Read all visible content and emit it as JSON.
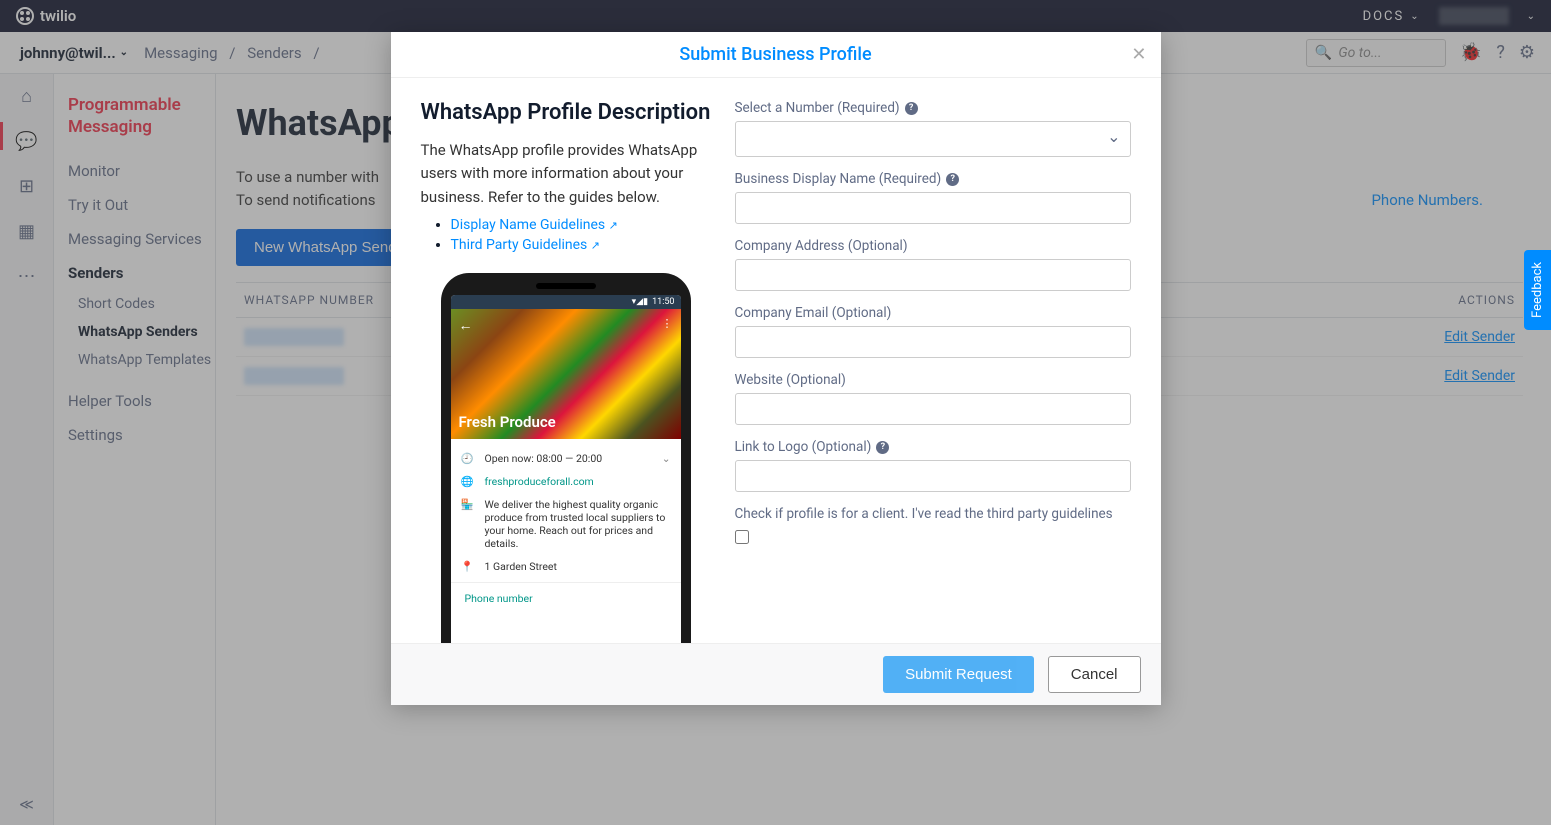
{
  "topbar": {
    "brand": "twilio",
    "docs": "DOCS"
  },
  "secondbar": {
    "account": "johnny@twil...",
    "crumb1": "Messaging",
    "crumb2": "Senders",
    "search_placeholder": "Go to..."
  },
  "sidebar": {
    "title": "Programmable Messaging",
    "items": {
      "monitor": "Monitor",
      "tryit": "Try it Out",
      "services": "Messaging Services",
      "senders": "Senders",
      "short_codes": "Short Codes",
      "whatsapp_senders": "WhatsApp Senders",
      "whatsapp_templates": "WhatsApp Templates",
      "helper": "Helper Tools",
      "settings": "Settings"
    }
  },
  "page": {
    "title": "WhatsApp",
    "desc1": "To use a number with",
    "desc2": "To send notifications",
    "link_phone": "Phone Numbers.",
    "btn_new": "New WhatsApp Sender",
    "col_number": "WHATSAPP NUMBER",
    "col_actions": "ACTIONS",
    "action_edit": "Edit Sender"
  },
  "modal": {
    "title": "Submit Business Profile",
    "section_heading": "WhatsApp Profile Description",
    "intro": "The WhatsApp profile provides WhatsApp users with more information about your business. Refer to the guides below.",
    "link1": "Display Name Guidelines",
    "link2": "Third Party Guidelines",
    "labels": {
      "number": "Select a Number (Required)",
      "display_name": "Business Display Name (Required)",
      "address": "Company Address (Optional)",
      "email": "Company Email (Optional)",
      "website": "Website (Optional)",
      "logo": "Link to Logo (Optional)",
      "client_check": "Check if profile is for a client. I've read the third party guidelines"
    },
    "footer": {
      "submit": "Submit Request",
      "cancel": "Cancel"
    }
  },
  "phone_preview": {
    "time": "11:50",
    "title": "Fresh Produce",
    "hours": "Open now: 08:00 — 20:00",
    "site": "freshproduceforall.com",
    "desc": "We deliver the highest quality organic produce from trusted local suppliers to your home. Reach out for prices and details.",
    "addr": "1 Garden Street",
    "phone": "Phone number"
  },
  "feedback": "Feedback"
}
